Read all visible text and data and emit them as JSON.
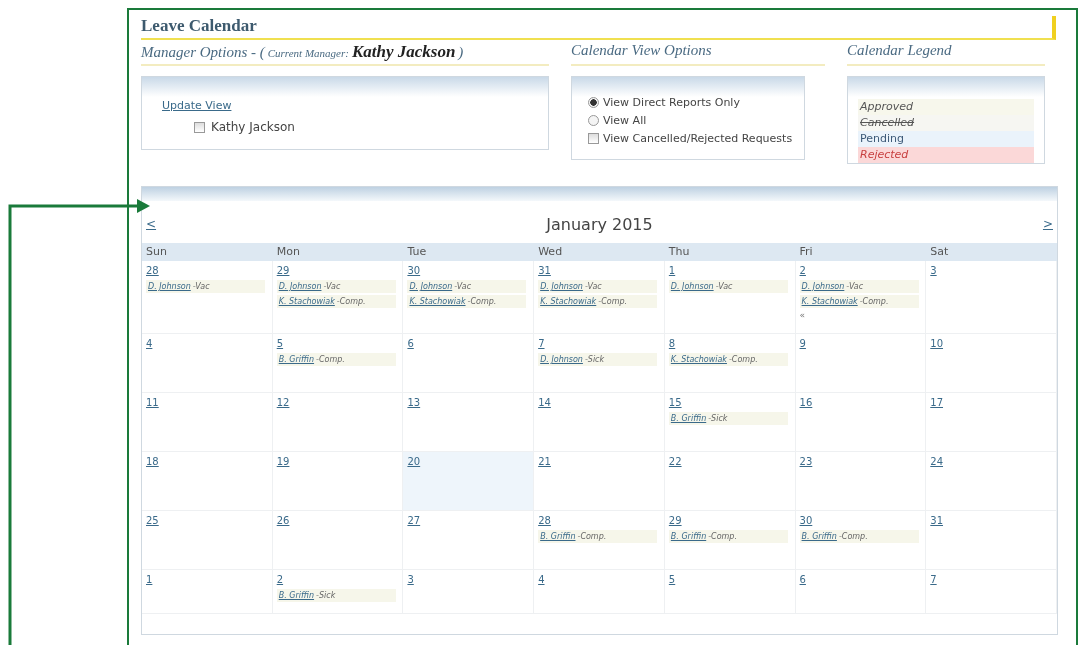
{
  "page": {
    "title": "Leave Calendar"
  },
  "manager_options": {
    "heading": "Manager Options - (",
    "current_label": "Current Manager:",
    "current_manager": "Kathy Jackson",
    "closing": ")",
    "update_link": "Update View",
    "employees": [
      {
        "label": "Kathy Jackson",
        "checked": false
      }
    ]
  },
  "view_options": {
    "heading": "Calendar View Options",
    "options": [
      {
        "kind": "radio",
        "label": "View Direct Reports Only",
        "checked": true
      },
      {
        "kind": "radio",
        "label": "View All",
        "checked": false
      },
      {
        "kind": "checkbox",
        "label": "View Cancelled/Rejected Requests",
        "checked": false
      }
    ]
  },
  "legend": {
    "heading": "Calendar Legend",
    "items": [
      {
        "kind": "approved",
        "label": "Approved"
      },
      {
        "kind": "cancelled",
        "label": "Cancelled"
      },
      {
        "kind": "pending",
        "label": "Pending"
      },
      {
        "kind": "rejected",
        "label": "Rejected"
      }
    ]
  },
  "calendar": {
    "prev": "<",
    "month": "January 2015",
    "next": ">",
    "weekdays": [
      "Sun",
      "Mon",
      "Tue",
      "Wed",
      "Thu",
      "Fri",
      "Sat"
    ],
    "weeks": [
      [
        {
          "day": "28",
          "entries": [
            {
              "name": "D. Johnson",
              "type": "-Vac"
            }
          ]
        },
        {
          "day": "29",
          "entries": [
            {
              "name": "D. Johnson",
              "type": "-Vac"
            },
            {
              "name": "K. Stachowiak",
              "type": "-Comp."
            }
          ]
        },
        {
          "day": "30",
          "entries": [
            {
              "name": "D. Johnson",
              "type": "-Vac"
            },
            {
              "name": "K. Stachowiak",
              "type": "-Comp."
            }
          ]
        },
        {
          "day": "31",
          "entries": [
            {
              "name": "D. Johnson",
              "type": "-Vac"
            },
            {
              "name": "K. Stachowiak",
              "type": "-Comp."
            }
          ]
        },
        {
          "day": "1",
          "entries": [
            {
              "name": "D. Johnson",
              "type": "-Vac"
            }
          ]
        },
        {
          "day": "2",
          "entries": [
            {
              "name": "D. Johnson",
              "type": "-Vac"
            },
            {
              "name": "K. Stachowiak",
              "type": "-Comp."
            }
          ],
          "more": "«"
        },
        {
          "day": "3"
        }
      ],
      [
        {
          "day": "4"
        },
        {
          "day": "5",
          "entries": [
            {
              "name": "B. Griffin",
              "type": "-Comp."
            }
          ]
        },
        {
          "day": "6"
        },
        {
          "day": "7",
          "entries": [
            {
              "name": "D. Johnson",
              "type": "-Sick"
            }
          ]
        },
        {
          "day": "8",
          "entries": [
            {
              "name": "K. Stachowiak",
              "type": "-Comp."
            }
          ]
        },
        {
          "day": "9"
        },
        {
          "day": "10"
        }
      ],
      [
        {
          "day": "11"
        },
        {
          "day": "12"
        },
        {
          "day": "13"
        },
        {
          "day": "14"
        },
        {
          "day": "15",
          "entries": [
            {
              "name": "B. Griffin",
              "type": "-Sick"
            }
          ]
        },
        {
          "day": "16"
        },
        {
          "day": "17"
        }
      ],
      [
        {
          "day": "18"
        },
        {
          "day": "19"
        },
        {
          "day": "20",
          "today": true
        },
        {
          "day": "21"
        },
        {
          "day": "22"
        },
        {
          "day": "23"
        },
        {
          "day": "24"
        }
      ],
      [
        {
          "day": "25"
        },
        {
          "day": "26"
        },
        {
          "day": "27"
        },
        {
          "day": "28",
          "entries": [
            {
              "name": "B. Griffin",
              "type": "-Comp."
            }
          ]
        },
        {
          "day": "29",
          "entries": [
            {
              "name": "B. Griffin",
              "type": "-Comp."
            }
          ]
        },
        {
          "day": "30",
          "entries": [
            {
              "name": "B. Griffin",
              "type": "-Comp."
            }
          ]
        },
        {
          "day": "31"
        }
      ],
      [
        {
          "day": "1"
        },
        {
          "day": "2",
          "entries": [
            {
              "name": "B. Griffin",
              "type": "-Sick"
            }
          ]
        },
        {
          "day": "3"
        },
        {
          "day": "4"
        },
        {
          "day": "5"
        },
        {
          "day": "6"
        },
        {
          "day": "7"
        }
      ]
    ]
  }
}
